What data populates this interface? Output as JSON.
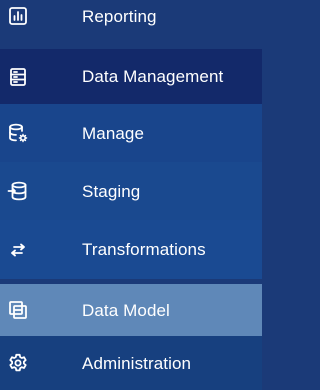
{
  "sidebar": {
    "items": [
      {
        "label": "Reporting",
        "icon": "bar-chart-icon"
      },
      {
        "label": "Data Management",
        "icon": "table-icon"
      },
      {
        "label": "Manage",
        "icon": "database-gear-icon"
      },
      {
        "label": "Staging",
        "icon": "database-import-icon"
      },
      {
        "label": "Transformations",
        "icon": "swap-arrows-icon"
      },
      {
        "label": "Data Model",
        "icon": "stacked-boxes-icon"
      },
      {
        "label": "Administration",
        "icon": "gear-icon"
      }
    ]
  },
  "colors": {
    "background": "#1b3a78",
    "active_item": "#13296a",
    "hover_item": "#5f88b8",
    "text": "#ffffff"
  }
}
